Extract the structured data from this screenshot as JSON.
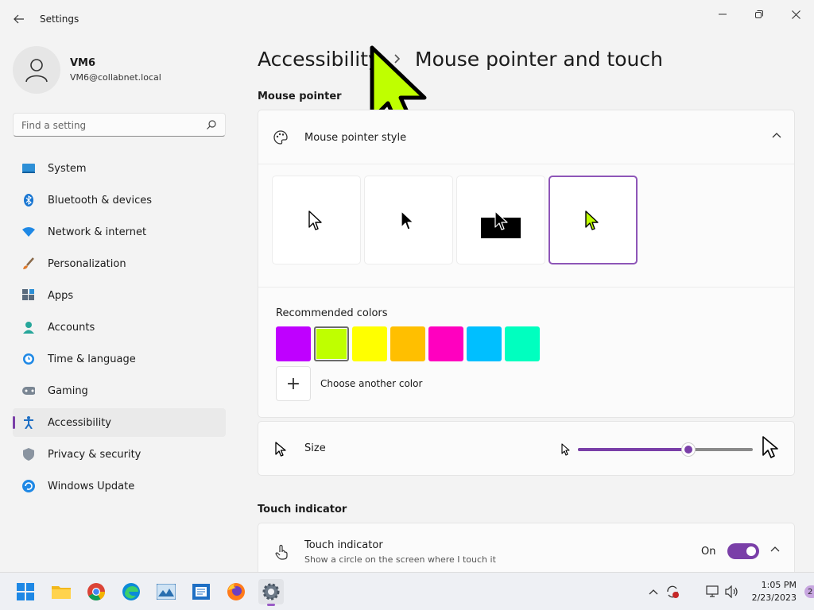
{
  "app": {
    "title": "Settings"
  },
  "profile": {
    "name": "VM6",
    "email": "VM6@collabnet.local"
  },
  "search": {
    "placeholder": "Find a setting"
  },
  "nav": [
    {
      "label": "System",
      "icon": "system-icon"
    },
    {
      "label": "Bluetooth & devices",
      "icon": "bluetooth-icon"
    },
    {
      "label": "Network & internet",
      "icon": "network-icon"
    },
    {
      "label": "Personalization",
      "icon": "brush-icon"
    },
    {
      "label": "Apps",
      "icon": "apps-icon"
    },
    {
      "label": "Accounts",
      "icon": "accounts-icon"
    },
    {
      "label": "Time & language",
      "icon": "clock-icon"
    },
    {
      "label": "Gaming",
      "icon": "gamepad-icon"
    },
    {
      "label": "Accessibility",
      "icon": "accessibility-icon",
      "active": true
    },
    {
      "label": "Privacy & security",
      "icon": "shield-icon"
    },
    {
      "label": "Windows Update",
      "icon": "update-icon"
    }
  ],
  "breadcrumb": {
    "parent": "Accessibility",
    "separator": "›",
    "current": "Mouse pointer and touch"
  },
  "mouse_pointer": {
    "section_title": "Mouse pointer",
    "style_label": "Mouse pointer style",
    "styles": [
      "white",
      "black",
      "inverted",
      "custom"
    ],
    "selected_style": "custom",
    "recommended_label": "Recommended colors",
    "colors": [
      "#bf00ff",
      "#bfff00",
      "#ffff00",
      "#ffbf00",
      "#ff00bf",
      "#00bfff",
      "#00ffbf"
    ],
    "selected_color": "#bfff00",
    "choose_color_label": "Choose another color",
    "add_symbol": "+"
  },
  "size": {
    "label": "Size",
    "value_fraction": 0.63
  },
  "touch": {
    "section_title": "Touch indicator",
    "label": "Touch indicator",
    "description": "Show a circle on the screen where I touch it",
    "state_label": "On",
    "enabled": true
  },
  "taskbar": {
    "apps": [
      "start-icon",
      "file-explorer-icon",
      "chrome-icon",
      "edge-icon",
      "photos-icon",
      "notepad-icon",
      "firefox-icon",
      "settings-icon"
    ],
    "time": "1:05 PM",
    "date": "2/23/2023",
    "notification_count": "2"
  },
  "colors": {
    "accent": "#7a3fa8",
    "background": "#f3f3f3",
    "card": "#fbfbfb",
    "cursor_fill": "#bfff00"
  }
}
